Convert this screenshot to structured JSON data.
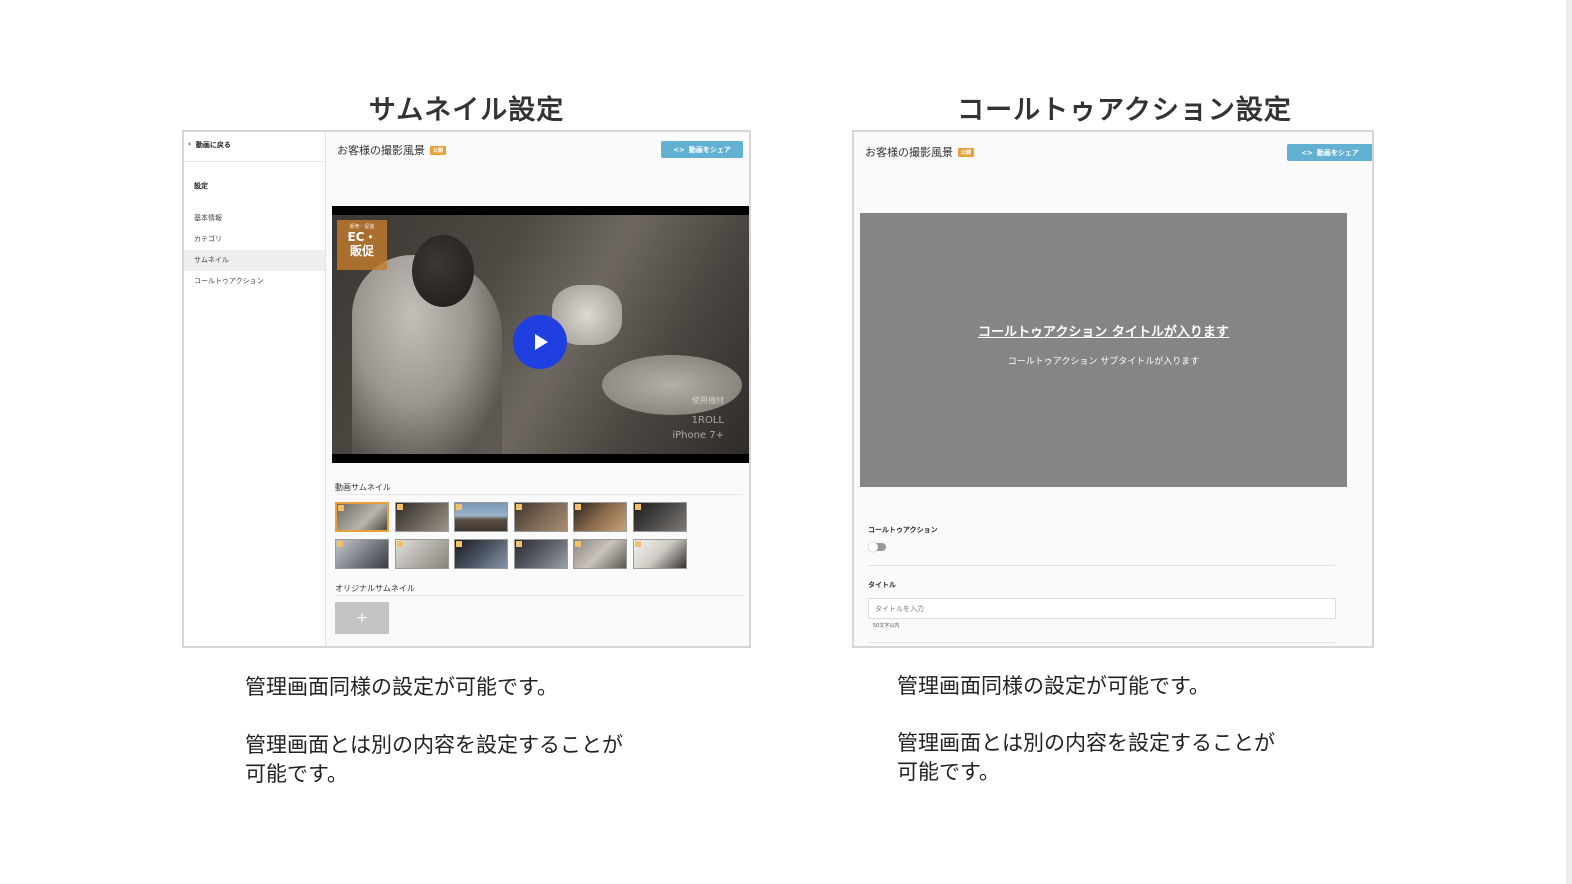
{
  "left": {
    "heading": "サムネイル設定",
    "screenshot": {
      "back_link": "動画に戻る",
      "sidebar_heading": "設定",
      "sidebar_items": [
        {
          "label": "基本情報"
        },
        {
          "label": "カテゴリ"
        },
        {
          "label": "サムネイル",
          "active": true
        },
        {
          "label": "コールトゥアクション"
        }
      ],
      "video_title": "お客様の撮影風景",
      "status_badge": "公開",
      "share_button": "動画をシェア",
      "video_overlay": {
        "ec_small": "販売・促進",
        "ec_big_line1": "EC・",
        "ec_big_line2": "販促",
        "watermark_1": "使用機材",
        "watermark_2": "1ROLL",
        "watermark_3": "iPhone 7+"
      },
      "thumbnail_section_title": "動画サムネイル",
      "original_section_title": "オリジナルサムネイル",
      "add_button": "+"
    },
    "caption_line1": "管理画面同様の設定が可能です。",
    "caption_line2": "管理画面とは別の内容を設定することが",
    "caption_line3": "可能です。"
  },
  "right": {
    "heading": "コールトゥアクション設定",
    "screenshot": {
      "video_title": "お客様の撮影風景",
      "status_badge": "公開",
      "share_button": "動画をシェア",
      "cta_title": "コールトゥアクション タイトルが入ります",
      "cta_subtitle": "コールトゥアクション サブタイトルが入ります",
      "toggle_label": "コールトゥアクション",
      "toggle_on": false,
      "title_label": "タイトル",
      "title_placeholder": "タイトルを入力",
      "title_hint": "50文字以内"
    },
    "caption_line1": "管理画面同様の設定が可能です。",
    "caption_line2": "管理画面とは別の内容を設定することが",
    "caption_line3": "可能です。"
  },
  "colors": {
    "share_button": "#62b1d2",
    "badge": "#e8a13a",
    "play_button": "#1f3fe0",
    "cta_background": "#858585"
  }
}
